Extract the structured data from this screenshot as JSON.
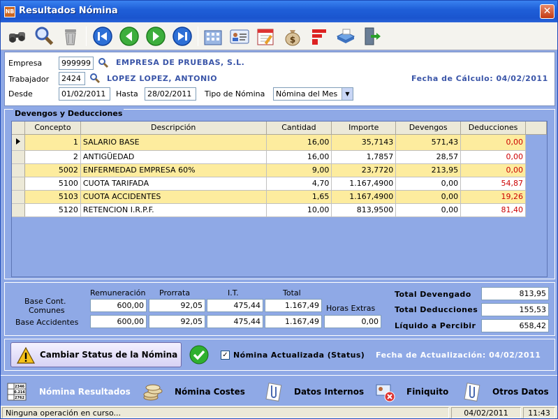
{
  "window": {
    "title": "Resultados Nómina",
    "app_icon": "NB"
  },
  "header": {
    "empresa_label": "Empresa",
    "empresa_value": "999999",
    "empresa_name": "EMPRESA DE PRUEBAS, S.L.",
    "trabajador_label": "Trabajador",
    "trabajador_value": "2424",
    "trabajador_name": "LOPEZ LOPEZ, ANTONIO",
    "fecha_calculo": "Fecha de Cálculo:  04/02/2011",
    "desde_label": "Desde",
    "desde_value": "01/02/2011",
    "hasta_label": "Hasta",
    "hasta_value": "28/02/2011",
    "tipo_label": "Tipo de Nómina",
    "tipo_value": "Nómina del Mes"
  },
  "group": {
    "title": "Devengos y Deducciones",
    "columns": [
      "Concepto",
      "Descripción",
      "Cantidad",
      "Importe",
      "Devengos",
      "Deducciones"
    ],
    "rows": [
      [
        "1",
        "SALARIO BASE",
        "16,00",
        "35,7143",
        "571,43",
        "0,00"
      ],
      [
        "2",
        "ANTIGÜEDAD",
        "16,00",
        "1,7857",
        "28,57",
        "0,00"
      ],
      [
        "5002",
        "ENFERMEDAD EMPRESA 60%",
        "9,00",
        "23,7720",
        "213,95",
        "0,00"
      ],
      [
        "5100",
        "CUOTA TARIFADA",
        "4,70",
        "1.167,4900",
        "0,00",
        "54,87"
      ],
      [
        "5103",
        "CUOTA ACCIDENTES",
        "1,65",
        "1.167,4900",
        "0,00",
        "19,26"
      ],
      [
        "5120",
        "RETENCION I.R.P.F.",
        "10,00",
        "813,9500",
        "0,00",
        "81,40"
      ]
    ]
  },
  "totals": {
    "col_remuneracion": "Remuneración",
    "col_prorrata": "Prorrata",
    "col_it": "I.T.",
    "col_total": "Total",
    "base_comunes_label_1": "Base Cont.",
    "base_comunes_label_2": "Comunes",
    "base_accidentes_label": "Base Accidentes",
    "comunes": [
      "600,00",
      "92,05",
      "475,44",
      "1.167,49"
    ],
    "accidentes": [
      "600,00",
      "92,05",
      "475,44",
      "1.167,49"
    ],
    "horas_extras_label": "Horas Extras",
    "horas_extras_value": "0,00",
    "total_devengado_label": "Total Devengado",
    "total_devengado_value": "813,95",
    "total_deducciones_label": "Total Deducciones",
    "total_deducciones_value": "155,53",
    "liquido_label": "Líquido a Percibir",
    "liquido_value": "658,42"
  },
  "status": {
    "button_label": "Cambiar Status de la Nómina",
    "checkbox_label": "Nómina Actualizada (Status)",
    "checkbox_mark": "✓",
    "fecha_actualizacion": "Fecha de Actualización:  04/02/2011"
  },
  "tabs": [
    {
      "label": "Nómina Resultados",
      "icon": "table-icon"
    },
    {
      "label": "Nómina Costes",
      "icon": "coins-icon"
    },
    {
      "label": "Datos Internos",
      "icon": "paperclip-icon"
    },
    {
      "label": "Finiquito",
      "icon": "finiquito-icon"
    },
    {
      "label": "Otros Datos",
      "icon": "paperclip-icon"
    }
  ],
  "statusbar": {
    "message": "Ninguna operación en curso...",
    "date": "04/02/2011",
    "time": "11:43"
  },
  "colors": {
    "panel_blue": "#8fa9e6",
    "row_yellow": "#fdec9e",
    "deduction_red": "#cc0000",
    "label_blue": "#3a55a8"
  }
}
